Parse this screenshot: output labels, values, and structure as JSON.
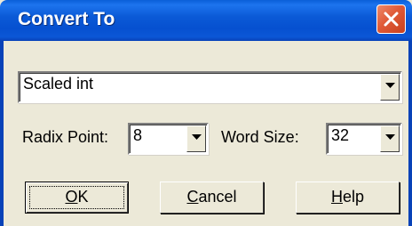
{
  "window": {
    "title": "Convert To"
  },
  "type_combo": {
    "value": "Scaled int"
  },
  "radix_point": {
    "label": "Radix Point:",
    "value": "8"
  },
  "word_size": {
    "label": "Word Size:",
    "value": "32"
  },
  "buttons": {
    "ok": {
      "mnemonic": "O",
      "rest": "K"
    },
    "cancel": {
      "mnemonic": "C",
      "rest": "ancel"
    },
    "help": {
      "mnemonic": "H",
      "rest": "elp"
    }
  },
  "icons": {
    "close": "close-icon",
    "dropdown": "chevron-down-icon"
  },
  "colors": {
    "titlebar": "#0b5ad7",
    "close": "#e05a37",
    "face": "#ece9d8"
  }
}
